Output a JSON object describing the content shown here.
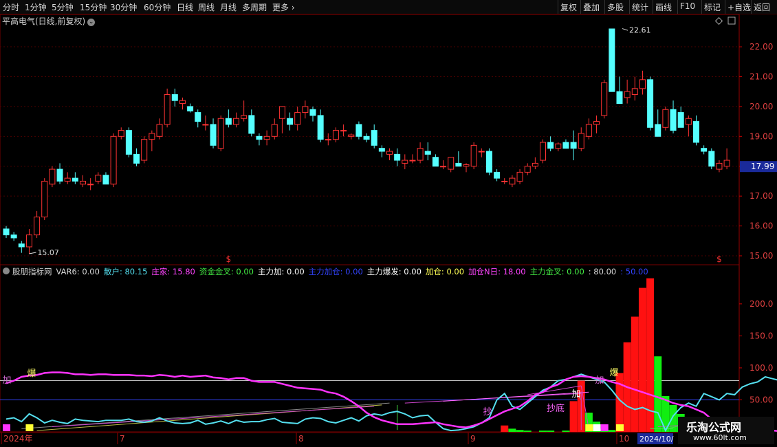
{
  "toolbar": {
    "periods": [
      "分时",
      "1分钟",
      "5分钟",
      "15分钟",
      "30分钟",
      "60分钟",
      "日线",
      "周线",
      "月线",
      "多周期",
      "更多"
    ],
    "active_period": "日线",
    "right_buttons": [
      "复权",
      "叠加",
      "多股",
      "统计",
      "画线",
      "F10",
      "标记",
      "+自选",
      "返回"
    ]
  },
  "price_panel": {
    "title": "平高电气(日线,前复权)",
    "current_price": "17.99",
    "high_label": "22.61",
    "low_label": "15.07",
    "y_ticks": [
      "22.00",
      "21.00",
      "20.00",
      "19.00",
      "18.00",
      "17.00",
      "16.00",
      "15.00"
    ],
    "signal_marks": [
      "$",
      "$"
    ]
  },
  "indicator_panel": {
    "title_parts": [
      {
        "text": "股朋指标网",
        "color": "#d8d8d8"
      },
      {
        "text": "VAR6: 0.00",
        "color": "#d8d8d8"
      },
      {
        "text": "散户: 80.15",
        "color": "#55e0f0"
      },
      {
        "text": "庄家: 15.80",
        "color": "#ff44ff"
      },
      {
        "text": "资金金叉: 0.00",
        "color": "#44ee44"
      },
      {
        "text": "主力加: 0.00",
        "color": "#ffffff"
      },
      {
        "text": "主力加仓: 0.00",
        "color": "#3344ff"
      },
      {
        "text": "主力爆发: 0.00",
        "color": "#ffffff"
      },
      {
        "text": "加仓: 0.00",
        "color": "#ffff55"
      },
      {
        "text": "加仓N日: 18.00",
        "color": "#ff44ff"
      },
      {
        "text": "主力金叉: 0.00",
        "color": "#44ee44"
      },
      {
        "text": ": 80.00",
        "color": "#d8d8d8"
      },
      {
        "text": ": 50.00",
        "color": "#3344ff"
      }
    ],
    "y_ticks": [
      "200.0",
      "150.0",
      "100.0",
      "50.00"
    ],
    "annotations": {
      "add1": "加",
      "burst1": "爆",
      "add2": "加",
      "burst2": "爆",
      "add3": "加",
      "bottom1": "抄",
      "bottom2": "抄底"
    }
  },
  "x_axis": {
    "labels": [
      "2024年",
      "7",
      "8",
      "9",
      "10",
      "2024/10/"
    ]
  },
  "watermark": {
    "line1": "乐淘公式网",
    "line2": "www.60lt.com"
  },
  "colors": {
    "up": "#ff3333",
    "down": "#55ffff",
    "grid": "#4a0000",
    "axis_text": "#e04040"
  },
  "chart_data": {
    "type": "candlestick",
    "candles": [
      {
        "o": 15.9,
        "h": 16.0,
        "l": 15.6,
        "c": 15.7
      },
      {
        "o": 15.7,
        "h": 15.8,
        "l": 15.5,
        "c": 15.6
      },
      {
        "o": 15.4,
        "h": 15.5,
        "l": 15.1,
        "c": 15.3
      },
      {
        "o": 15.3,
        "h": 15.9,
        "l": 15.07,
        "c": 15.7
      },
      {
        "o": 15.7,
        "h": 16.5,
        "l": 15.6,
        "c": 16.3
      },
      {
        "o": 16.3,
        "h": 17.6,
        "l": 16.2,
        "c": 17.5
      },
      {
        "o": 17.4,
        "h": 18.0,
        "l": 17.3,
        "c": 17.9
      },
      {
        "o": 17.9,
        "h": 18.1,
        "l": 17.4,
        "c": 17.5
      },
      {
        "o": 17.5,
        "h": 17.8,
        "l": 17.4,
        "c": 17.6
      },
      {
        "o": 17.6,
        "h": 17.8,
        "l": 17.4,
        "c": 17.5
      },
      {
        "o": 17.4,
        "h": 17.7,
        "l": 17.3,
        "c": 17.5
      },
      {
        "o": 17.4,
        "h": 17.6,
        "l": 17.2,
        "c": 17.4
      },
      {
        "o": 17.5,
        "h": 17.8,
        "l": 17.4,
        "c": 17.7
      },
      {
        "o": 17.7,
        "h": 17.8,
        "l": 17.4,
        "c": 17.4
      },
      {
        "o": 17.4,
        "h": 19.1,
        "l": 17.3,
        "c": 19.0
      },
      {
        "o": 19.0,
        "h": 19.3,
        "l": 18.9,
        "c": 19.2
      },
      {
        "o": 19.2,
        "h": 19.3,
        "l": 18.3,
        "c": 18.4
      },
      {
        "o": 18.4,
        "h": 18.6,
        "l": 18.0,
        "c": 18.1
      },
      {
        "o": 18.2,
        "h": 19.0,
        "l": 18.1,
        "c": 18.9
      },
      {
        "o": 18.9,
        "h": 19.2,
        "l": 18.5,
        "c": 19.1
      },
      {
        "o": 19.0,
        "h": 19.6,
        "l": 18.9,
        "c": 19.4
      },
      {
        "o": 19.4,
        "h": 20.6,
        "l": 19.3,
        "c": 20.4
      },
      {
        "o": 20.4,
        "h": 20.6,
        "l": 20.0,
        "c": 20.2
      },
      {
        "o": 20.1,
        "h": 20.3,
        "l": 19.9,
        "c": 20.2
      },
      {
        "o": 20.0,
        "h": 20.1,
        "l": 19.8,
        "c": 19.85
      },
      {
        "o": 19.8,
        "h": 19.9,
        "l": 19.3,
        "c": 19.5
      },
      {
        "o": 19.4,
        "h": 19.7,
        "l": 19.2,
        "c": 19.4
      },
      {
        "o": 19.4,
        "h": 19.6,
        "l": 18.6,
        "c": 18.7
      },
      {
        "o": 18.6,
        "h": 19.7,
        "l": 18.5,
        "c": 19.6
      },
      {
        "o": 19.6,
        "h": 19.9,
        "l": 19.3,
        "c": 19.4
      },
      {
        "o": 19.4,
        "h": 19.8,
        "l": 19.3,
        "c": 19.6
      },
      {
        "o": 19.6,
        "h": 20.2,
        "l": 19.5,
        "c": 19.7
      },
      {
        "o": 19.7,
        "h": 19.9,
        "l": 19.0,
        "c": 19.1
      },
      {
        "o": 19.0,
        "h": 19.1,
        "l": 18.7,
        "c": 18.9
      },
      {
        "o": 18.9,
        "h": 19.2,
        "l": 18.7,
        "c": 19.0
      },
      {
        "o": 19.0,
        "h": 19.6,
        "l": 18.9,
        "c": 19.4
      },
      {
        "o": 19.6,
        "h": 19.9,
        "l": 19.1,
        "c": 20.0
      },
      {
        "o": 19.6,
        "h": 19.8,
        "l": 19.2,
        "c": 19.4
      },
      {
        "o": 19.4,
        "h": 20.0,
        "l": 19.2,
        "c": 19.8
      },
      {
        "o": 19.8,
        "h": 20.2,
        "l": 19.6,
        "c": 20.0
      },
      {
        "o": 19.9,
        "h": 20.0,
        "l": 19.5,
        "c": 19.7
      },
      {
        "o": 19.7,
        "h": 19.9,
        "l": 18.8,
        "c": 18.9
      },
      {
        "o": 18.9,
        "h": 19.1,
        "l": 18.7,
        "c": 18.9
      },
      {
        "o": 18.9,
        "h": 19.3,
        "l": 18.8,
        "c": 19.2
      },
      {
        "o": 19.2,
        "h": 19.4,
        "l": 19.0,
        "c": 19.2
      },
      {
        "o": 19.0,
        "h": 19.1,
        "l": 18.9,
        "c": 19.05
      },
      {
        "o": 19.4,
        "h": 19.5,
        "l": 18.9,
        "c": 19.0
      },
      {
        "o": 19.0,
        "h": 19.1,
        "l": 18.8,
        "c": 18.9
      },
      {
        "o": 19.2,
        "h": 19.4,
        "l": 18.6,
        "c": 18.7
      },
      {
        "o": 18.6,
        "h": 18.7,
        "l": 18.3,
        "c": 18.5
      },
      {
        "o": 18.4,
        "h": 18.6,
        "l": 18.2,
        "c": 18.5
      },
      {
        "o": 18.4,
        "h": 18.6,
        "l": 18.0,
        "c": 18.2
      },
      {
        "o": 18.1,
        "h": 18.4,
        "l": 17.9,
        "c": 18.2
      },
      {
        "o": 18.2,
        "h": 18.4,
        "l": 18.1,
        "c": 18.2
      },
      {
        "o": 18.2,
        "h": 18.8,
        "l": 18.1,
        "c": 18.6
      },
      {
        "o": 18.5,
        "h": 18.8,
        "l": 18.2,
        "c": 18.4
      },
      {
        "o": 18.3,
        "h": 18.4,
        "l": 18.0,
        "c": 18.0
      },
      {
        "o": 18.0,
        "h": 18.2,
        "l": 17.9,
        "c": 18.0
      },
      {
        "o": 17.9,
        "h": 18.3,
        "l": 17.8,
        "c": 18.3
      },
      {
        "o": 18.1,
        "h": 18.5,
        "l": 18.0,
        "c": 18.0
      },
      {
        "o": 18.0,
        "h": 18.1,
        "l": 17.8,
        "c": 18.05
      },
      {
        "o": 18.0,
        "h": 18.8,
        "l": 17.9,
        "c": 18.7
      },
      {
        "o": 18.5,
        "h": 18.6,
        "l": 18.3,
        "c": 18.5
      },
      {
        "o": 18.5,
        "h": 18.6,
        "l": 17.7,
        "c": 17.8
      },
      {
        "o": 17.8,
        "h": 17.9,
        "l": 17.5,
        "c": 17.6
      },
      {
        "o": 17.5,
        "h": 17.6,
        "l": 17.4,
        "c": 17.5
      },
      {
        "o": 17.4,
        "h": 17.7,
        "l": 17.3,
        "c": 17.6
      },
      {
        "o": 17.5,
        "h": 17.9,
        "l": 17.4,
        "c": 17.8
      },
      {
        "o": 17.8,
        "h": 18.1,
        "l": 17.7,
        "c": 18.0
      },
      {
        "o": 18.0,
        "h": 18.3,
        "l": 17.9,
        "c": 18.1
      },
      {
        "o": 18.2,
        "h": 18.9,
        "l": 18.1,
        "c": 18.8
      },
      {
        "o": 18.8,
        "h": 19.0,
        "l": 18.5,
        "c": 18.6
      },
      {
        "o": 18.6,
        "h": 18.8,
        "l": 18.5,
        "c": 18.75
      },
      {
        "o": 18.8,
        "h": 18.9,
        "l": 18.6,
        "c": 18.6
      },
      {
        "o": 18.8,
        "h": 19.2,
        "l": 18.2,
        "c": 18.6
      },
      {
        "o": 18.6,
        "h": 19.3,
        "l": 18.5,
        "c": 19.1
      },
      {
        "o": 19.0,
        "h": 19.6,
        "l": 18.9,
        "c": 19.4
      },
      {
        "o": 19.4,
        "h": 19.7,
        "l": 19.1,
        "c": 19.5
      },
      {
        "o": 19.7,
        "h": 20.9,
        "l": 19.6,
        "c": 20.8
      },
      {
        "o": 22.6,
        "h": 22.61,
        "l": 20.8,
        "c": 20.5
      },
      {
        "o": 20.5,
        "h": 21.0,
        "l": 20.1,
        "c": 20.1
      },
      {
        "o": 20.3,
        "h": 20.9,
        "l": 20.1,
        "c": 20.5
      },
      {
        "o": 20.4,
        "h": 21.0,
        "l": 20.2,
        "c": 20.6
      },
      {
        "o": 20.6,
        "h": 21.2,
        "l": 20.4,
        "c": 20.9
      },
      {
        "o": 20.9,
        "h": 21.0,
        "l": 19.2,
        "c": 19.3
      },
      {
        "o": 19.4,
        "h": 19.9,
        "l": 19.0,
        "c": 19.0
      },
      {
        "o": 19.3,
        "h": 20.0,
        "l": 19.2,
        "c": 19.9
      },
      {
        "o": 19.9,
        "h": 20.2,
        "l": 19.1,
        "c": 19.2
      },
      {
        "o": 19.8,
        "h": 20.0,
        "l": 19.3,
        "c": 19.3
      },
      {
        "o": 19.4,
        "h": 19.7,
        "l": 19.0,
        "c": 19.6
      },
      {
        "o": 19.5,
        "h": 19.7,
        "l": 18.7,
        "c": 18.8
      },
      {
        "o": 18.6,
        "h": 18.7,
        "l": 18.4,
        "c": 18.5
      },
      {
        "o": 18.5,
        "h": 18.6,
        "l": 17.9,
        "c": 18.0
      },
      {
        "o": 17.9,
        "h": 18.2,
        "l": 17.8,
        "c": 18.1
      },
      {
        "o": 18.0,
        "h": 18.6,
        "l": 17.9,
        "c": 18.2
      }
    ],
    "indicator": {
      "ylim": [
        0,
        245
      ],
      "bars": [
        {
          "i": 65,
          "v": 10,
          "c": "red"
        },
        {
          "i": 66,
          "v": 5,
          "c": "green"
        },
        {
          "i": 67,
          "v": 3,
          "c": "green"
        },
        {
          "i": 68,
          "v": 2,
          "c": "green"
        },
        {
          "i": 70,
          "v": 2,
          "c": "green"
        },
        {
          "i": 71,
          "v": 2,
          "c": "green"
        },
        {
          "i": 73,
          "v": 2,
          "c": "green"
        },
        {
          "i": 74,
          "v": 48,
          "c": "red"
        },
        {
          "i": 75,
          "v": 80,
          "c": "red"
        },
        {
          "i": 76,
          "v": 30,
          "c": "green"
        },
        {
          "i": 77,
          "v": 16,
          "c": "green"
        },
        {
          "i": 78,
          "v": 5,
          "c": "green"
        },
        {
          "i": 79,
          "v": 3,
          "c": "green"
        },
        {
          "i": 80,
          "v": 92,
          "c": "red"
        },
        {
          "i": 81,
          "v": 140,
          "c": "red"
        },
        {
          "i": 82,
          "v": 180,
          "c": "red"
        },
        {
          "i": 83,
          "v": 225,
          "c": "red"
        },
        {
          "i": 84,
          "v": 240,
          "c": "red"
        },
        {
          "i": 85,
          "v": 118,
          "c": "green"
        },
        {
          "i": 86,
          "v": 56,
          "c": "green"
        },
        {
          "i": 87,
          "v": 42,
          "c": "green"
        },
        {
          "i": 88,
          "v": 28,
          "c": "green"
        },
        {
          "i": 89,
          "v": 10,
          "c": "green"
        },
        {
          "i": 90,
          "v": 3,
          "c": "green"
        }
      ],
      "sanhu": [
        20,
        22,
        16,
        28,
        22,
        14,
        18,
        15,
        13,
        20,
        18,
        17,
        16,
        18,
        18,
        18,
        20,
        16,
        15,
        17,
        22,
        17,
        14,
        13,
        14,
        18,
        12,
        14,
        17,
        13,
        18,
        15,
        16,
        16,
        19,
        21,
        15,
        14,
        13,
        20,
        22,
        21,
        16,
        14,
        18,
        22,
        17,
        25,
        28,
        26,
        30,
        32,
        28,
        22,
        25,
        26,
        15,
        5,
        2,
        3,
        5,
        8,
        14,
        22,
        50,
        60,
        40,
        35,
        45,
        55,
        65,
        70,
        80,
        82,
        86,
        90,
        86,
        82,
        78,
        65,
        50,
        40,
        35,
        38,
        33,
        30,
        2,
        25,
        38,
        45,
        40,
        60,
        55,
        50,
        60,
        58,
        70,
        75,
        78,
        86,
        83,
        80
      ],
      "zhuangjia": [
        76,
        80,
        86,
        88,
        89,
        92,
        93,
        93,
        92,
        90,
        90,
        89,
        90,
        90,
        89,
        89,
        89,
        88,
        88,
        87,
        89,
        88,
        86,
        88,
        86,
        87,
        88,
        85,
        84,
        82,
        84,
        84,
        80,
        78,
        78,
        78,
        75,
        72,
        69,
        68,
        67,
        66,
        62,
        60,
        55,
        48,
        40,
        30,
        23,
        18,
        15,
        12,
        12,
        12,
        13,
        14,
        15,
        12,
        10,
        8,
        7,
        10,
        14,
        20,
        26,
        32,
        36,
        40,
        48,
        58,
        62,
        70,
        74,
        82,
        86,
        87,
        86,
        84,
        82,
        78,
        75,
        70,
        66,
        62,
        58,
        54,
        50,
        45,
        42,
        40,
        35,
        30,
        20,
        18,
        12,
        10,
        8,
        5,
        4,
        2,
        2,
        1
      ]
    }
  }
}
